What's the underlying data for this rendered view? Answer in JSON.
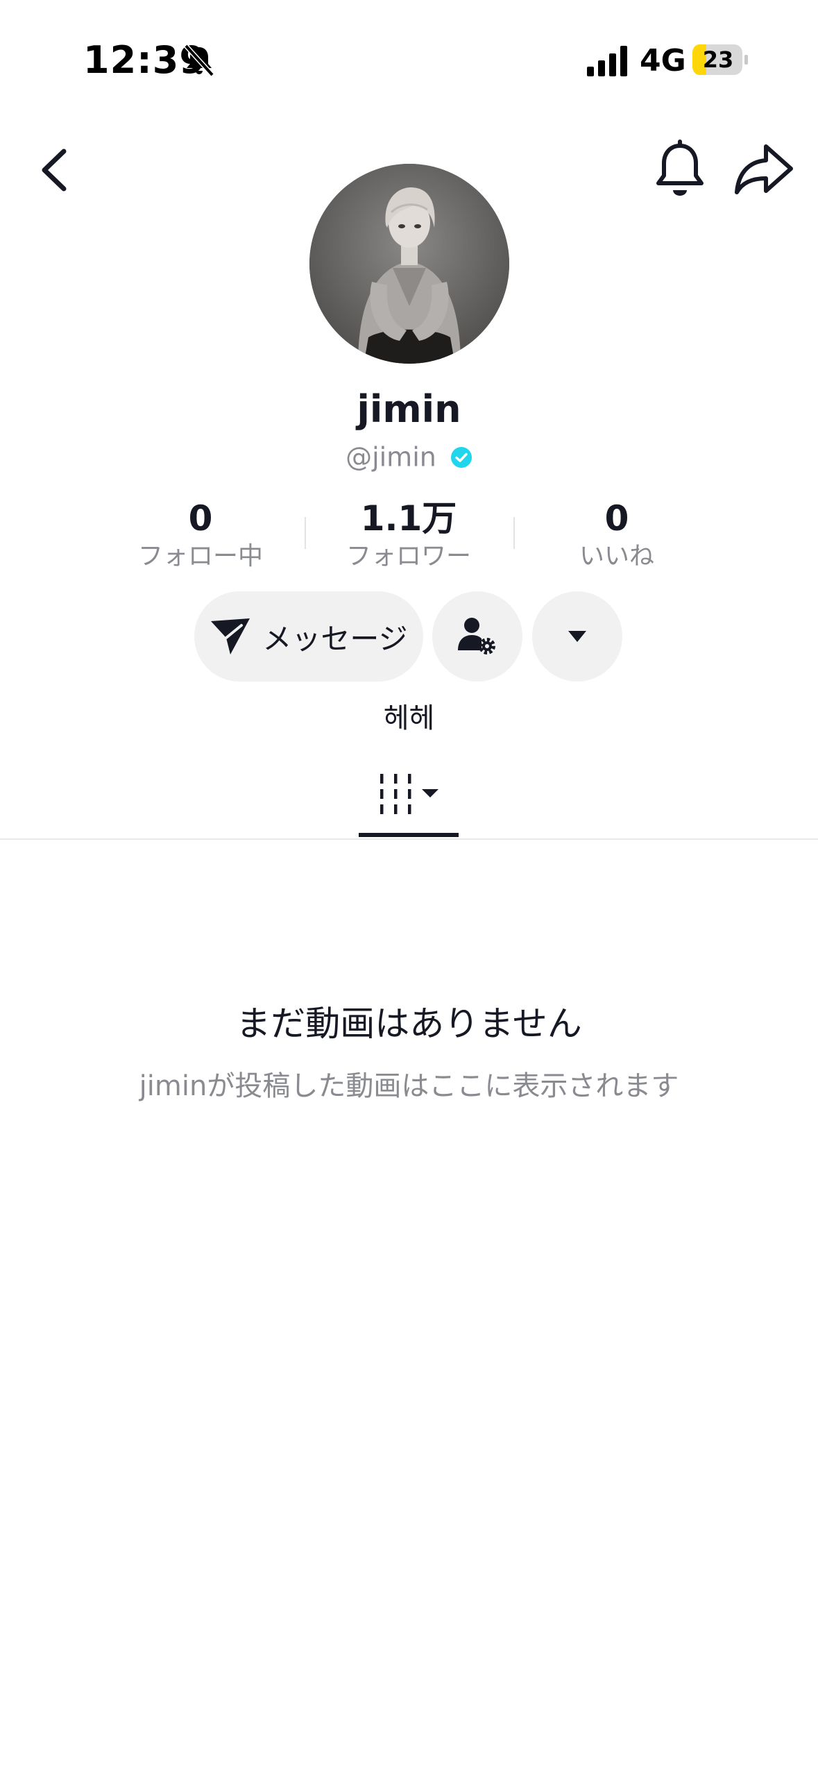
{
  "status_bar": {
    "time": "12:39",
    "network": "4G",
    "battery": "23"
  },
  "profile": {
    "display_name": "jimin",
    "handle": "@jimin",
    "bio": "헤헤"
  },
  "stats": [
    {
      "value": "0",
      "label": "フォロー中"
    },
    {
      "value": "1.1万",
      "label": "フォロワー"
    },
    {
      "value": "0",
      "label": "いいね"
    }
  ],
  "actions": {
    "message_label": "メッセージ"
  },
  "empty_state": {
    "title": "まだ動画はありません",
    "subtitle": "jiminが投稿した動画はここに表示されます"
  },
  "colors": {
    "verified": "#20d5ec",
    "battery_fill": "#ffd60a",
    "button_bg": "#f1f1f2"
  }
}
